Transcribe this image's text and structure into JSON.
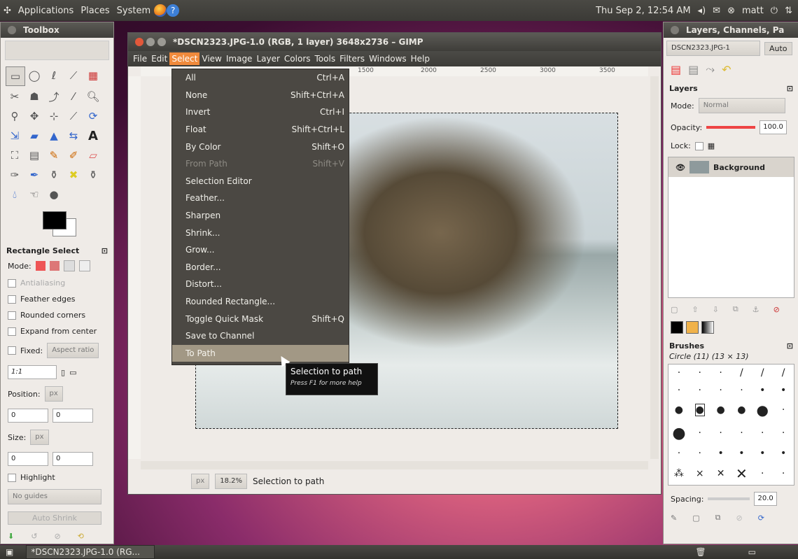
{
  "top_panel": {
    "applications": "Applications",
    "places": "Places",
    "system": "System",
    "datetime": "Thu Sep  2, 12:54 AM",
    "user": "matt",
    "icons": [
      "firefox-icon",
      "help-icon",
      "volume-icon",
      "mail-icon",
      "user-status-icon",
      "power-icon",
      "network-icon"
    ]
  },
  "toolbox": {
    "title": "Toolbox",
    "options_title": "Rectangle Select",
    "mode_label": "Mode:",
    "antialiasing": "Antialiasing",
    "feather_edges": "Feather edges",
    "rounded_corners": "Rounded corners",
    "expand_from_center": "Expand from center",
    "fixed_label": "Fixed:",
    "fixed_value": "Aspect ratio",
    "ratio": "1:1",
    "position_label": "Position:",
    "position_unit": "px",
    "position_x": "0",
    "position_y": "0",
    "size_label": "Size:",
    "size_unit": "px",
    "size_w": "0",
    "size_h": "0",
    "highlight": "Highlight",
    "guides": "No guides",
    "auto_shrink": "Auto Shrink"
  },
  "gimp_window": {
    "title": "*DSCN2323.JPG-1.0 (RGB, 1 layer) 3648x2736 – GIMP",
    "menus": [
      "File",
      "Edit",
      "Select",
      "View",
      "Image",
      "Layer",
      "Colors",
      "Tools",
      "Filters",
      "Windows",
      "Help"
    ],
    "ruler_ticks": [
      "1500",
      "2000",
      "2500",
      "3000",
      "3500"
    ],
    "status_unit": "px",
    "zoom": "18.2%",
    "status_text": "Selection to path"
  },
  "select_menu": [
    {
      "label": "All",
      "shortcut": "Ctrl+A",
      "disabled": false
    },
    {
      "label": "None",
      "shortcut": "Shift+Ctrl+A",
      "disabled": false
    },
    {
      "label": "Invert",
      "shortcut": "Ctrl+I",
      "disabled": false
    },
    {
      "label": "Float",
      "shortcut": "Shift+Ctrl+L",
      "disabled": false
    },
    {
      "label": "By Color",
      "shortcut": "Shift+O",
      "disabled": false
    },
    {
      "label": "From Path",
      "shortcut": "Shift+V",
      "disabled": true
    },
    {
      "label": "Selection Editor",
      "shortcut": "",
      "disabled": false
    },
    {
      "label": "Feather...",
      "shortcut": "",
      "disabled": false
    },
    {
      "label": "Sharpen",
      "shortcut": "",
      "disabled": false
    },
    {
      "label": "Shrink...",
      "shortcut": "",
      "disabled": false
    },
    {
      "label": "Grow...",
      "shortcut": "",
      "disabled": false
    },
    {
      "label": "Border...",
      "shortcut": "",
      "disabled": false
    },
    {
      "label": "Distort...",
      "shortcut": "",
      "disabled": false
    },
    {
      "label": "Rounded Rectangle...",
      "shortcut": "",
      "disabled": false
    },
    {
      "label": "Toggle Quick Mask",
      "shortcut": "Shift+Q",
      "disabled": false
    },
    {
      "label": "Save to Channel",
      "shortcut": "",
      "disabled": false
    },
    {
      "label": "To Path",
      "shortcut": "",
      "disabled": false,
      "highlighted": true
    }
  ],
  "tooltip": {
    "title": "Selection to path",
    "help": "Press F1 for more help"
  },
  "layers_dock": {
    "title": "Layers, Channels, Pa",
    "image_select": "DSCN2323.JPG-1",
    "auto_button": "Auto",
    "layers_label": "Layers",
    "mode_label": "Mode:",
    "mode_value": "Normal",
    "opacity_label": "Opacity:",
    "opacity_value": "100.0",
    "lock_label": "Lock:",
    "layer_name": "Background",
    "brushes_label": "Brushes",
    "brush_name": "Circle (11) (13 × 13)",
    "spacing_label": "Spacing:",
    "spacing_value": "20.0"
  },
  "taskbar": {
    "task": "*DSCN2323.JPG-1.0 (RG..."
  },
  "colors": {
    "menu_highlight": "#f08a3c",
    "menu_bg": "#4b4843",
    "item_highlight": "#a29885",
    "panel": "#3b3a36"
  }
}
